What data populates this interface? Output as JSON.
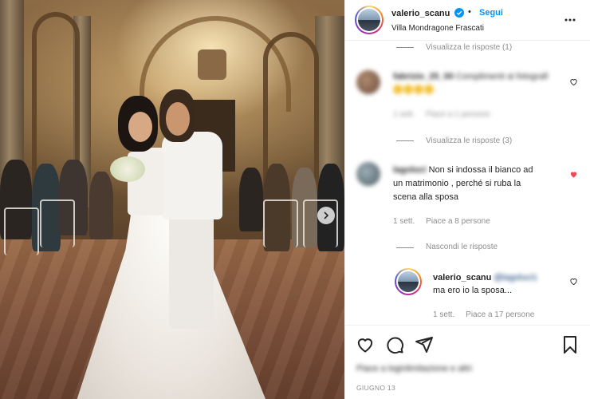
{
  "post": {
    "username": "valerio_scanu",
    "follow_label": "Segui",
    "location": "Villa Mondragone Frascati",
    "date": "GIUGNO 13",
    "likes_text": "Piace a loginlimitazione e altri"
  },
  "comments": {
    "top_view_replies": "Visualizza le risposte (1)",
    "c1": {
      "username": "fabrizio_25_00",
      "text": "Complimenti ai fotografi",
      "time": "1 sett.",
      "likes": "Piace a 1 persone"
    },
    "c1_view_replies": "Visualizza le risposte (3)",
    "c2": {
      "username": "lagoluci",
      "text_line1": "Non si indossa il bianco ad",
      "text_line2": "un matrimonio , perché si ruba la",
      "text_line3": "scena alla sposa",
      "time": "1 sett.",
      "likes": "Piace a 8 persone"
    },
    "hide_replies": "Nascondi le risposte",
    "reply": {
      "username": "valerio_scanu",
      "mention": "@lagoluci1",
      "text": "ma ero io la sposa...",
      "time": "1 sett.",
      "likes": "Piace a 17 persone"
    }
  },
  "icons": {
    "verified": "verified-badge-icon",
    "more": "more-options-icon",
    "heart": "heart-icon",
    "comment": "comment-icon",
    "share": "share-icon",
    "save": "bookmark-icon",
    "next": "chevron-right-icon"
  },
  "colors": {
    "accent": "#0095f6",
    "liked_heart": "#ed4956",
    "secondary_text": "#8e8e8e"
  }
}
